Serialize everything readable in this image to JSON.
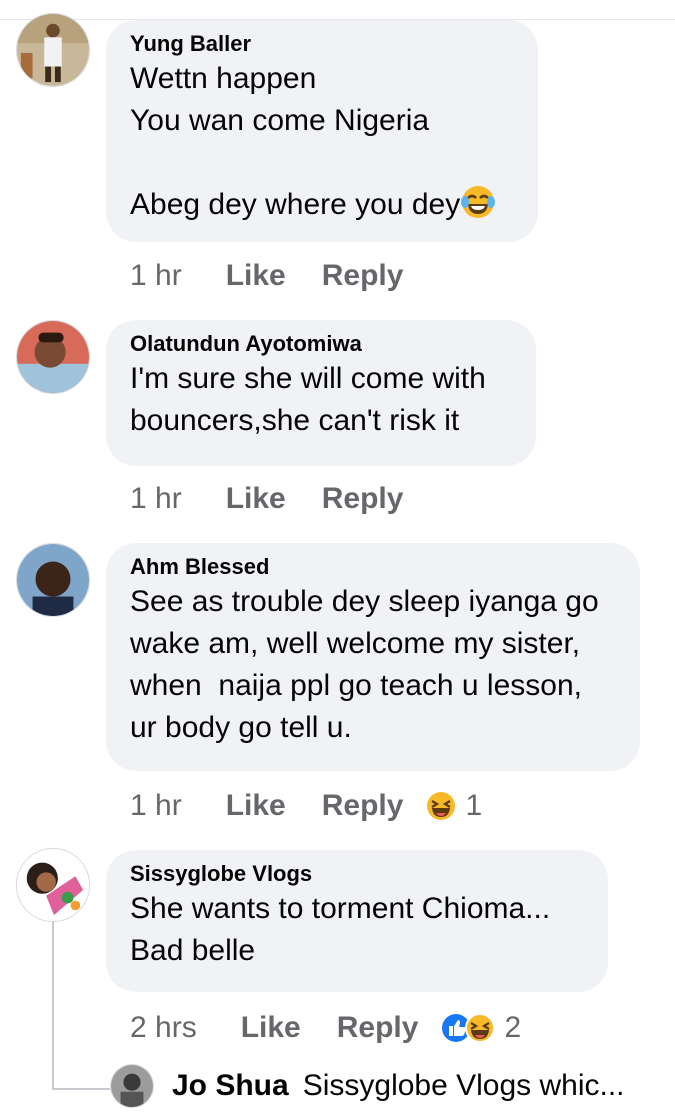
{
  "comments": [
    {
      "author": "Yung Baller",
      "text": "Wettn happen\nYou wan come Nigeria\n\nAbeg dey where you dey",
      "time": "1 hr",
      "like": "Like",
      "reply": "Reply",
      "avatar_icon": "profile-photo"
    },
    {
      "author": "Olatundun Ayotomiwa",
      "text": "I'm sure she will come with\nbouncers,she can't risk it",
      "time": "1 hr",
      "like": "Like",
      "reply": "Reply",
      "avatar_icon": "profile-photo"
    },
    {
      "author": "Ahm Blessed",
      "text": "See as trouble dey sleep iyanga go\nwake am, well welcome my sister,\nwhen  naija ppl go teach u lesson,\nur body go tell u.",
      "time": "1 hr",
      "like": "Like",
      "reply": "Reply",
      "reaction_count": "1",
      "reactions": [
        "haha-icon"
      ]
    },
    {
      "author": "Sissyglobe Vlogs",
      "text": "She wants to torment Chioma...\nBad belle",
      "time": "2 hrs",
      "like": "Like",
      "reply": "Reply",
      "reaction_count": "2",
      "reactions": [
        "like-icon",
        "haha-icon"
      ]
    }
  ],
  "reply_preview": {
    "author": "Jo Shua",
    "text": "Sissyglobe Vlogs whic..."
  },
  "colors": {
    "bubble": "#f0f2f5",
    "meta_text": "#65676b",
    "like_blue": "#1877f2",
    "haha_yellow": "#f7b928"
  }
}
